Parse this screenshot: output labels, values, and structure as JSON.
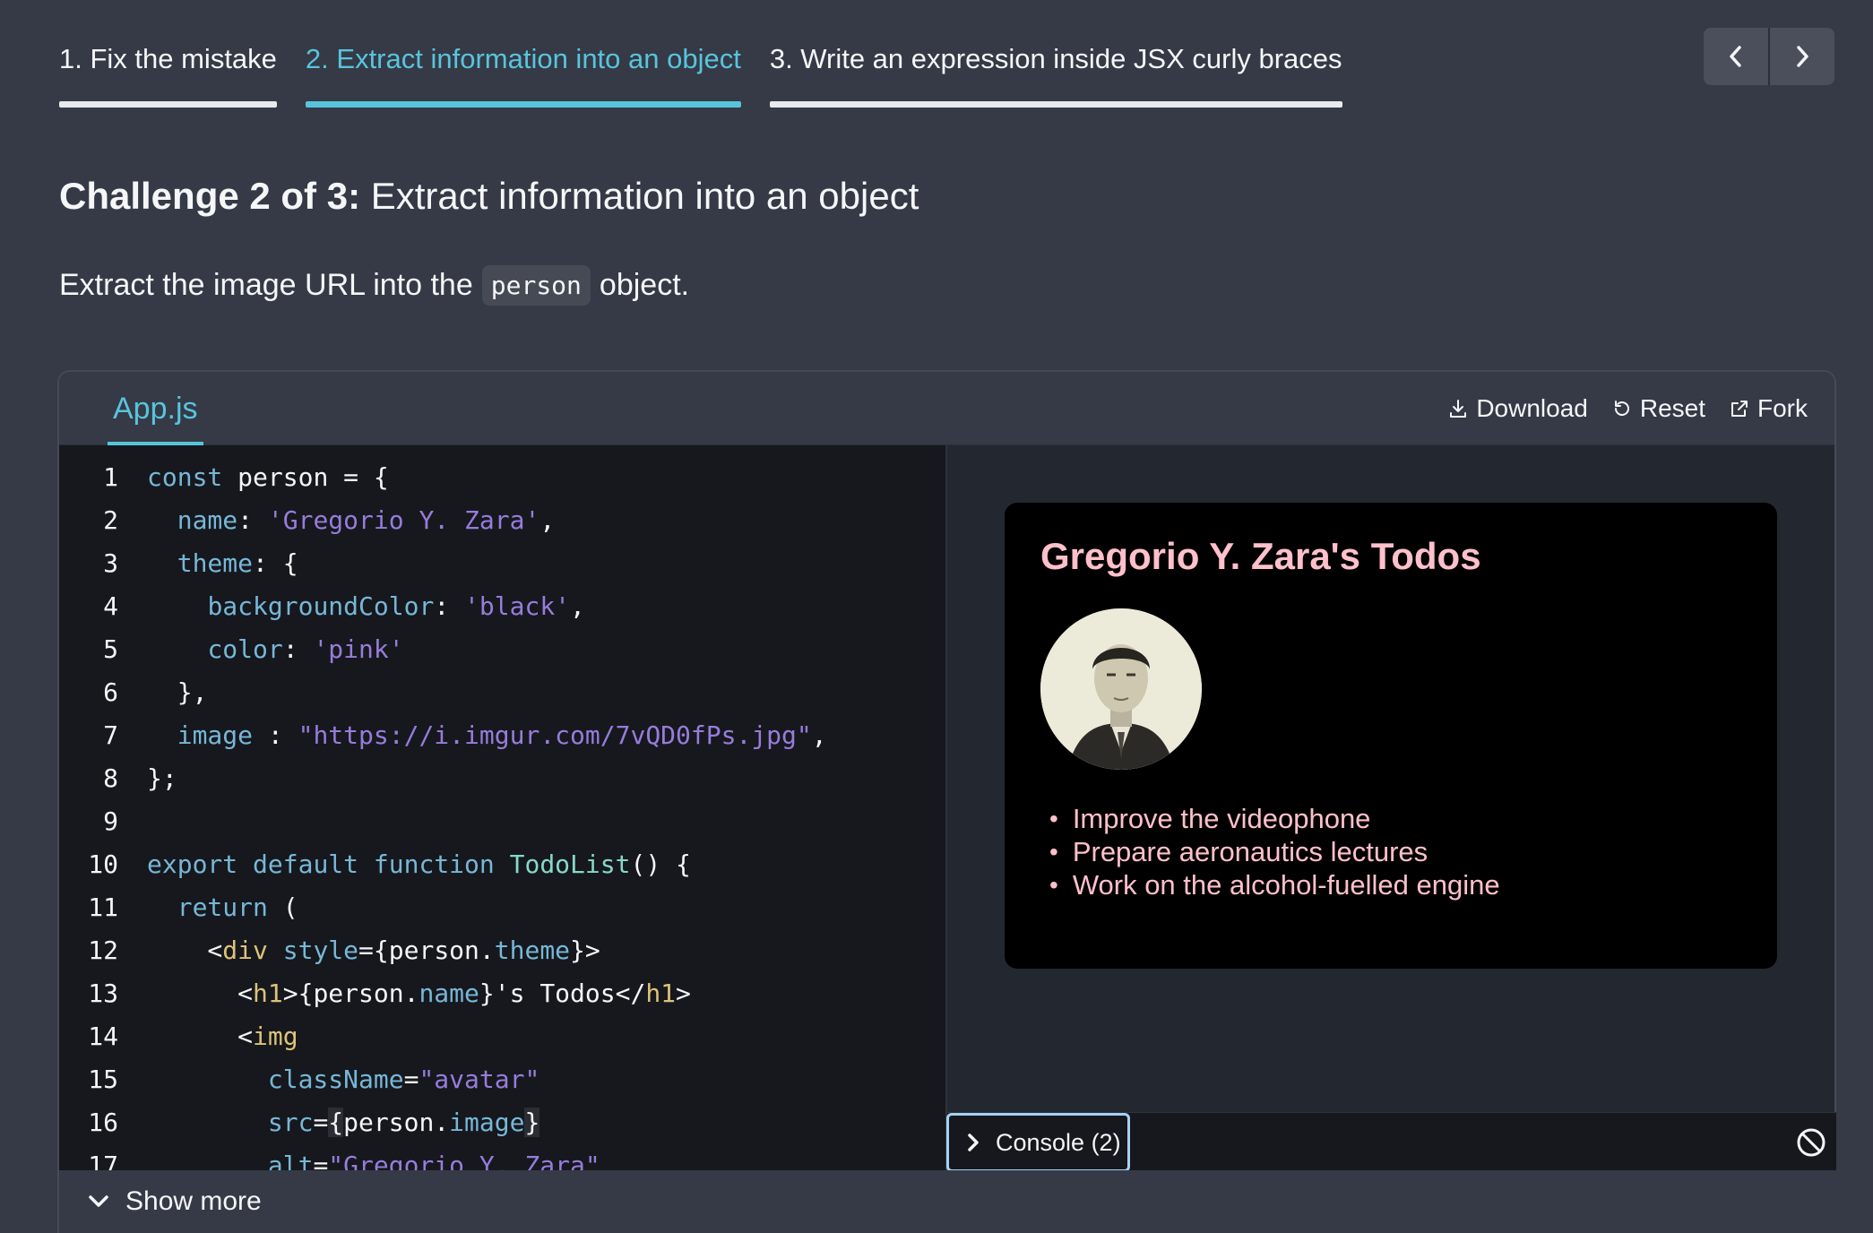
{
  "tabs": [
    {
      "label": "1. Fix the mistake"
    },
    {
      "label": "2. Extract information into an object"
    },
    {
      "label": "3. Write an expression inside JSX curly braces"
    }
  ],
  "nav": {
    "prev_icon": "chevron-left-icon",
    "next_icon": "chevron-right-icon"
  },
  "challenge": {
    "prefix": "Challenge 2 of 3:",
    "title": "Extract information into an object",
    "desc_before": "Extract the image URL into the",
    "desc_code": "person",
    "desc_after": "object."
  },
  "sandbox": {
    "file_tab": "App.js",
    "actions": {
      "download": "Download",
      "reset": "Reset",
      "fork": "Fork"
    }
  },
  "code_lines": [
    "const person = {",
    "  name: 'Gregorio Y. Zara',",
    "  theme: {",
    "    backgroundColor: 'black',",
    "    color: 'pink'",
    "  },",
    "  image : \"https://i.imgur.com/7vQD0fPs.jpg\",",
    "};",
    "",
    "export default function TodoList() {",
    "  return (",
    "    <div style={person.theme}>",
    "      <h1>{person.name}'s Todos</h1>",
    "      <img",
    "        className=\"avatar\"",
    "        src={person.image}",
    "        alt=\"Gregorio Y. Zara\""
  ],
  "preview": {
    "title": "Gregorio Y. Zara's Todos",
    "todos": [
      "Improve the videophone",
      "Prepare aeronautics lectures",
      "Work on the alcohol-fuelled engine"
    ]
  },
  "console": {
    "label": "Console (2)"
  },
  "show_more": {
    "label": "Show more"
  }
}
